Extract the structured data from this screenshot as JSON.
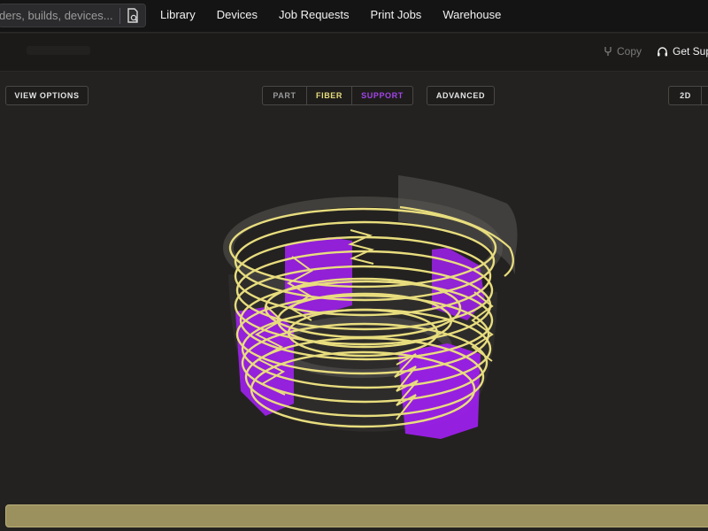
{
  "search": {
    "placeholder": "ders, builds, devices..."
  },
  "nav": {
    "items": [
      "Library",
      "Devices",
      "Job Requests",
      "Print Jobs",
      "Warehouse"
    ]
  },
  "subbar": {
    "copy_label": "Copy",
    "support_label": "Get Sup"
  },
  "toolbar": {
    "view_options": "VIEW OPTIONS",
    "segments": [
      {
        "label": "PART",
        "color": "#9a9a9a"
      },
      {
        "label": "FIBER",
        "color": "#e8dd7e"
      },
      {
        "label": "SUPPORT",
        "color": "#a345e8"
      }
    ],
    "advanced": "ADVANCED",
    "view_2d": "2D"
  },
  "icons": {
    "search_action": "search-in-page-icon",
    "copy": "fork-icon",
    "support": "headset-icon"
  },
  "colors": {
    "fiber": "#e8dd7e",
    "support": "#a020f0",
    "part": "#5a5856",
    "background": "#242220",
    "progress": "#9b915e"
  }
}
